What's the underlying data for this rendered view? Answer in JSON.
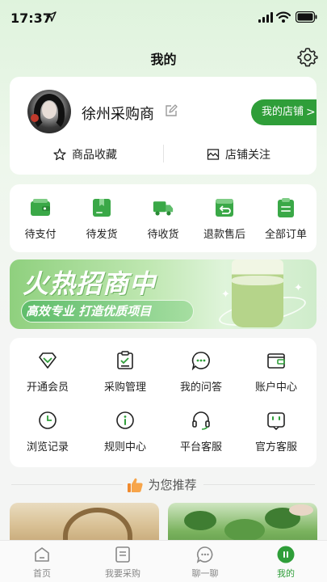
{
  "status_bar": {
    "time": "17:37"
  },
  "header": {
    "title": "我的"
  },
  "profile": {
    "name": "徐州采购商",
    "store_button": "我的店铺",
    "store_chevron": ">",
    "links": [
      "商品收藏",
      "店铺关注"
    ]
  },
  "orders": [
    {
      "label": "待支付",
      "icon": "wallet-icon"
    },
    {
      "label": "待发货",
      "icon": "box-icon"
    },
    {
      "label": "待收货",
      "icon": "truck-icon"
    },
    {
      "label": "退款售后",
      "icon": "refund-icon"
    },
    {
      "label": "全部订单",
      "icon": "clipboard-icon"
    }
  ],
  "banner": {
    "title": "火热招商中",
    "subtitle": "高效专业 打造优质项目"
  },
  "services": [
    {
      "label": "开通会员",
      "icon": "diamond-icon"
    },
    {
      "label": "采购管理",
      "icon": "clipboard-check-icon"
    },
    {
      "label": "我的问答",
      "icon": "chat-icon"
    },
    {
      "label": "账户中心",
      "icon": "wallet-outline-icon"
    },
    {
      "label": "浏览记录",
      "icon": "clock-icon"
    },
    {
      "label": "规则中心",
      "icon": "info-icon"
    },
    {
      "label": "平台客服",
      "icon": "headset-icon"
    },
    {
      "label": "官方客服",
      "icon": "service-face-icon"
    }
  ],
  "recommend": {
    "title": "为您推荐"
  },
  "tab_bar": [
    {
      "label": "首页",
      "icon": "home-icon"
    },
    {
      "label": "我要采购",
      "icon": "list-icon"
    },
    {
      "label": "聊一聊",
      "icon": "chat-bubble-icon"
    },
    {
      "label": "我的",
      "icon": "profile-icon",
      "active": true
    }
  ],
  "colors": {
    "accent": "#2f9e39",
    "background": "#f4f5f4"
  }
}
